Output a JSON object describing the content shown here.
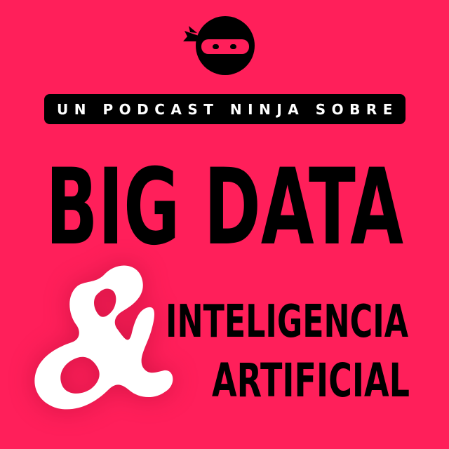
{
  "colors": {
    "background": "#ff1f5a",
    "ink": "#000000",
    "paper": "#ffffff"
  },
  "logo": {
    "icon": "ninja-head-icon"
  },
  "tagline": "UN PODCAST NINJA SOBRE",
  "headline": "BIG DATA",
  "ampersand": {
    "icon": "ampersand-icon"
  },
  "subtitle_line1": "INTELIGENCIA",
  "subtitle_line2": "ARTIFICIAL"
}
